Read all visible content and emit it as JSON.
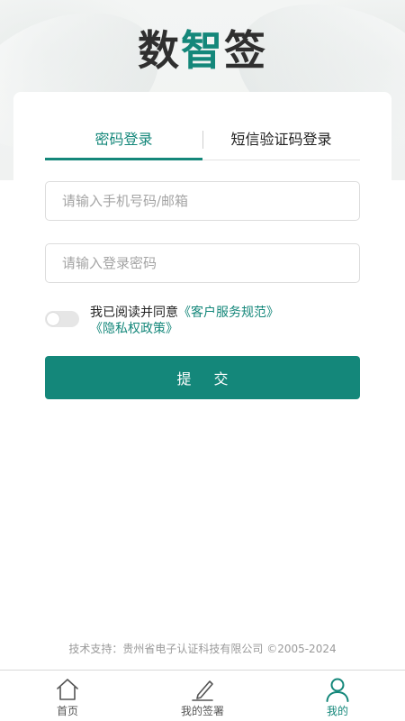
{
  "app": {
    "logo_text": "数智签"
  },
  "login": {
    "tabs": [
      {
        "label": "密码登录",
        "active": true
      },
      {
        "label": "短信验证码登录",
        "active": false
      }
    ],
    "account_placeholder": "请输入手机号码/邮箱",
    "password_placeholder": "请输入登录密码",
    "agree_prefix": "我已阅读并同意",
    "service_link": "《客户服务规范》",
    "privacy_link": "《隐私权政策》",
    "agree_checked": false,
    "submit_label": "提 交"
  },
  "footer": {
    "support_text": "技术支持：贵州省电子认证科技有限公司 ©2005-2024"
  },
  "tabbar": {
    "items": [
      {
        "label": "首页",
        "icon": "home-icon",
        "active": false
      },
      {
        "label": "我的签署",
        "icon": "pen-icon",
        "active": false
      },
      {
        "label": "我的",
        "icon": "user-icon",
        "active": true
      }
    ]
  },
  "colors": {
    "accent": "#14877a",
    "text": "#222222",
    "placeholder": "#a4a4a4",
    "footer_text": "#9a9a9a"
  }
}
